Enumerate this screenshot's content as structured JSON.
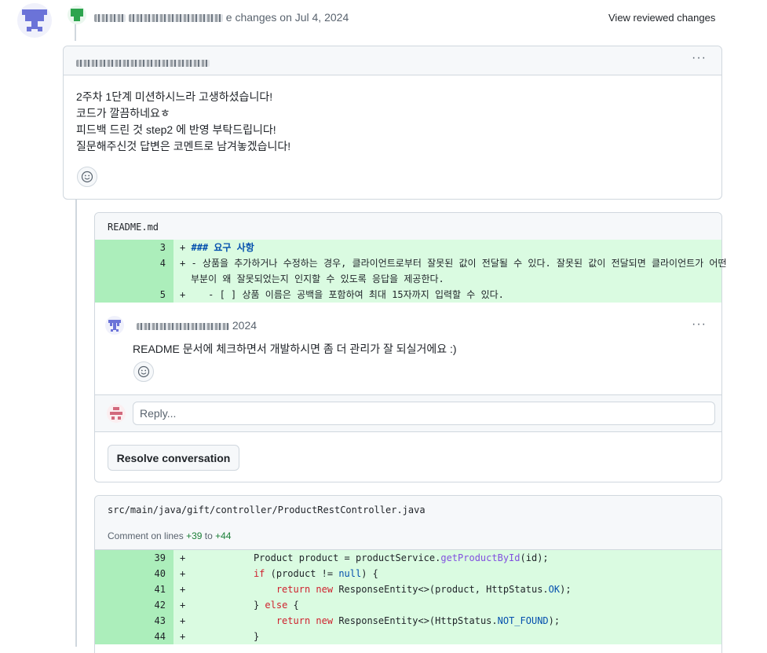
{
  "header": {
    "action_text": "e changes on Jul 4, 2024",
    "view_reviewed_label": "View reviewed changes"
  },
  "review": {
    "more_label": "···",
    "body_lines": [
      "2주차 1단계 미션하시느라 고생하셨습니다!",
      "코드가 깔끔하네요ㅎ",
      "피드백 드린 것 step2 에 반영 부탁드립니다!",
      "질문해주신것 답변은 코멘트로 남겨놓겠습니다!"
    ]
  },
  "file1": {
    "name": "README.md",
    "lines": [
      {
        "num": "3",
        "sign": "+",
        "text": "### 요구 사항"
      },
      {
        "num": "4",
        "sign": "+",
        "text": "- 상품을 추가하거나 수정하는 경우, 클라이언트로부터 잘못된 값이 전달될 수 있다. 잘못된 값이 전달되면 클라이언트가 어떤",
        "text_cont": "부분이 왜 잘못되었는지 인지할 수 있도록 응답을 제공한다."
      },
      {
        "num": "5",
        "sign": "+",
        "text": "- [ ] 상품 이름은 공백을 포함하여 최대 15자까지 입력할 수 있다."
      }
    ],
    "comment": {
      "date_suffix": "2024",
      "more_label": "···",
      "body": "README 문서에 체크하면서 개발하시면 좀 더 관리가 잘 되실거에요 :)"
    },
    "reply_placeholder": "Reply...",
    "resolve_label": "Resolve conversation"
  },
  "file2": {
    "name": "src/main/java/gift/controller/ProductRestController.java",
    "comment_range": {
      "prefix": "Comment on lines",
      "start": "+39",
      "to": "to",
      "end": "+44"
    },
    "lines": [
      {
        "num": "39",
        "sign": "+"
      },
      {
        "num": "40",
        "sign": "+"
      },
      {
        "num": "41",
        "sign": "+"
      },
      {
        "num": "42",
        "sign": "+"
      },
      {
        "num": "43",
        "sign": "+"
      },
      {
        "num": "44",
        "sign": "+"
      }
    ],
    "code": {
      "l39": {
        "a": "        Product product = productService.",
        "fn": "getProductById",
        "b": "(id);"
      },
      "l40": {
        "kw": "if",
        "a": " (product != ",
        "cst": "null",
        "b": ") {"
      },
      "l41": {
        "kw1": "return",
        "kw2": "new",
        "a": " ResponseEntity<>(product, HttpStatus.",
        "cst": "OK",
        "b": ");"
      },
      "l42": {
        "a": "        } ",
        "kw": "else",
        "b": " {"
      },
      "l43": {
        "kw1": "return",
        "kw2": "new",
        "a": " ResponseEntity<>(HttpStatus.",
        "cst": "NOT_FOUND",
        "b": ");"
      },
      "l44": {
        "a": "        }"
      }
    }
  },
  "colors": {
    "added_num_bg": "#aceebb",
    "added_code_bg": "#dafbe1",
    "border": "#d0d7de",
    "header_bg": "#f6f8fa"
  }
}
